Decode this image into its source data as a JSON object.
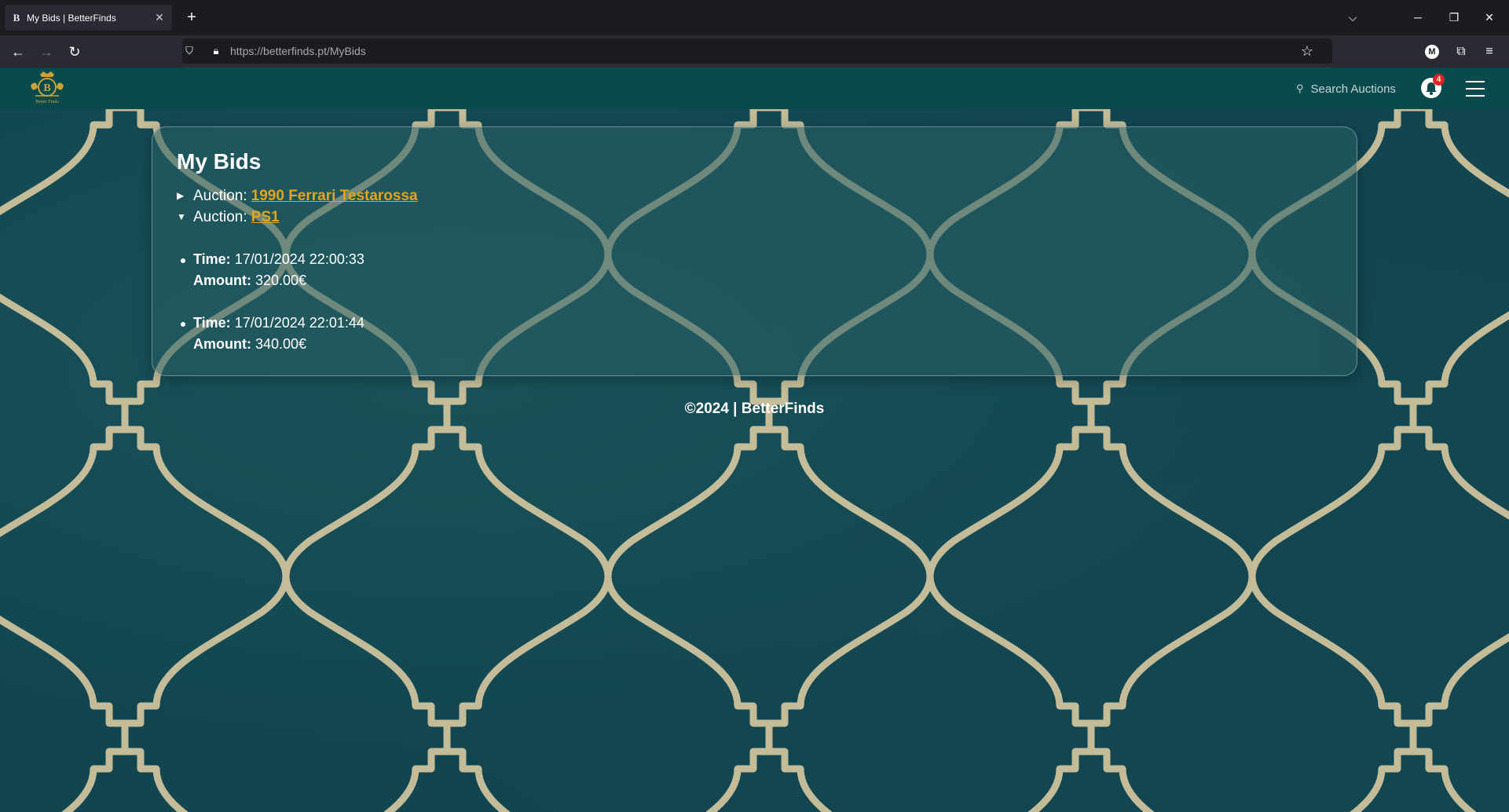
{
  "browser": {
    "tab_title": "My Bids | BetterFinds",
    "tab_favicon": "B",
    "url_host": "https://betterfinds.pt",
    "url_path": "/MyBids",
    "account_initial": "M"
  },
  "site": {
    "logo_caption": "Better Finds",
    "search_placeholder": "Search Auctions",
    "notification_count": "4"
  },
  "page": {
    "title": "My Bids",
    "auction_prefix": "Auction:",
    "auctions": [
      {
        "name": "1990 Ferrari Testarossa",
        "expanded": false
      },
      {
        "name": "PS1",
        "expanded": true
      }
    ],
    "bids": [
      {
        "time_label": "Time:",
        "time": "17/01/2024 22:00:33",
        "amount_label": "Amount:",
        "amount": "320.00€"
      },
      {
        "time_label": "Time:",
        "time": "17/01/2024 22:01:44",
        "amount_label": "Amount:",
        "amount": "340.00€"
      }
    ],
    "footer": "©2024 | BetterFinds"
  },
  "colors": {
    "accent_link": "#e4a418",
    "header_bg": "#0a4a4d",
    "background": "#114651",
    "pattern_gold": "#d8c9a0"
  }
}
